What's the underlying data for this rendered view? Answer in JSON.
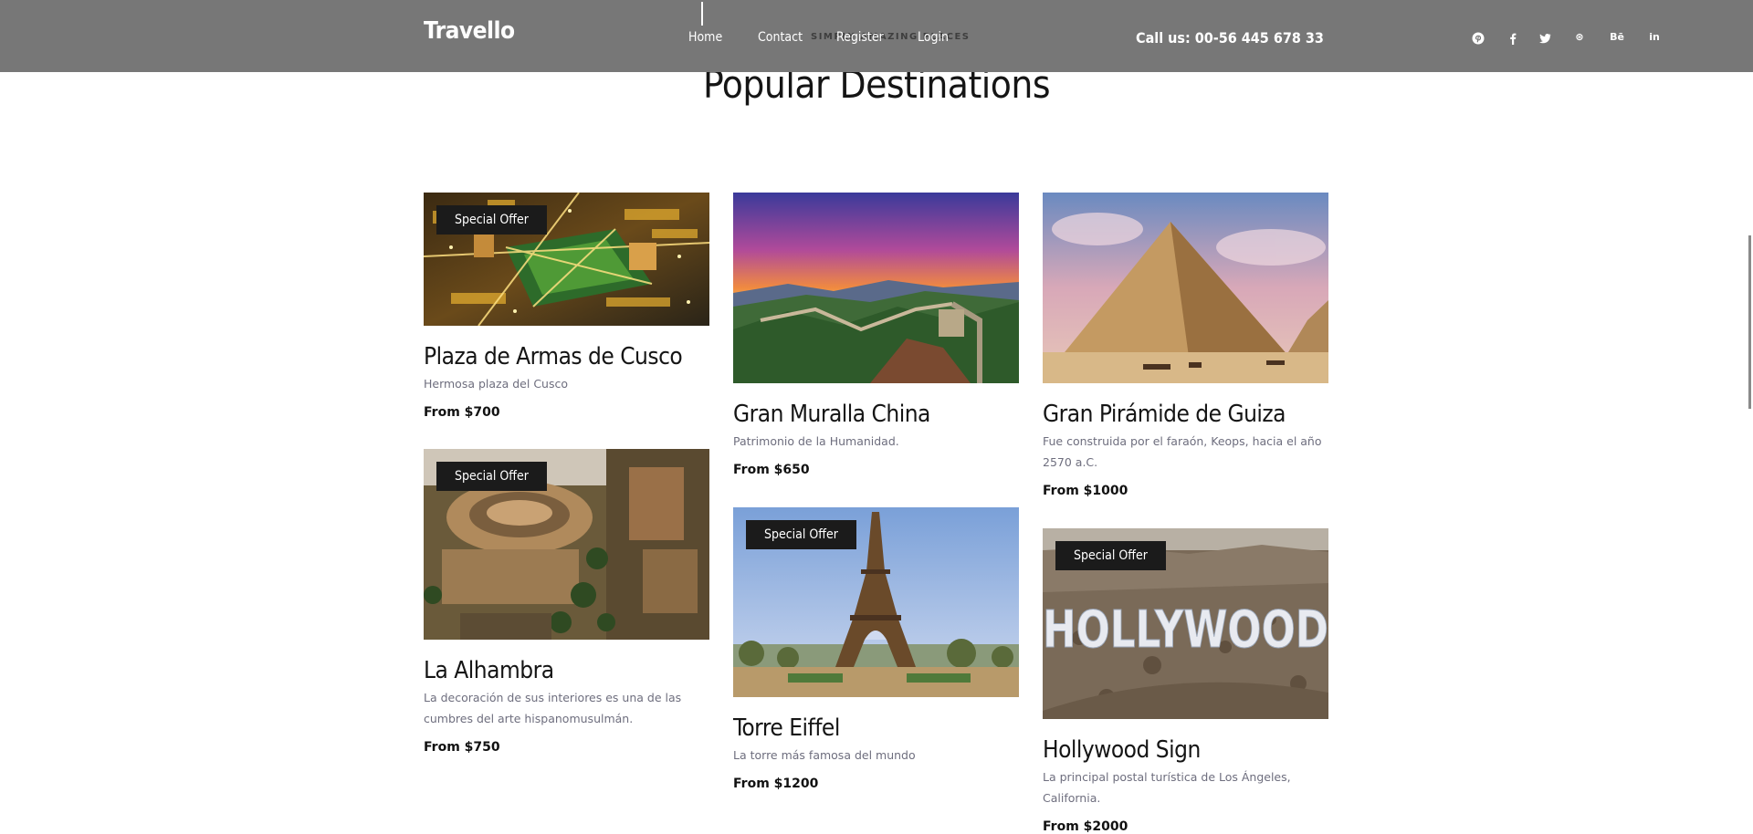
{
  "header": {
    "brand": "Travello",
    "ghost_text": "SIMPLY AMAZING PLACES",
    "nav": [
      {
        "label": "Home"
      },
      {
        "label": "Contact"
      },
      {
        "label": "Register"
      },
      {
        "label": "Login"
      }
    ],
    "phone": "Call us: 00-56 445 678 33",
    "social": [
      {
        "icon": "pinterest-icon"
      },
      {
        "icon": "facebook-icon"
      },
      {
        "icon": "twitter-icon"
      },
      {
        "icon": "dribbble-icon",
        "label": "⊛"
      },
      {
        "icon": "behance-icon",
        "label": "Bē"
      },
      {
        "icon": "linkedin-icon",
        "label": "in"
      }
    ]
  },
  "section": {
    "title": "Popular Destinations"
  },
  "destinations": [
    {
      "name": "Plaza de Armas de Cusco",
      "description": "Hermosa plaza del Cusco",
      "price": "From $700",
      "badge": "Special Offer"
    },
    {
      "name": "La Alhambra",
      "description": "La decoración de sus interiores es una de las cumbres del arte hispanomusulmán.",
      "price": "From $750",
      "badge": "Special Offer"
    },
    {
      "name": "Gran Muralla China",
      "description": "Patrimonio de la Humanidad.",
      "price": "From $650"
    },
    {
      "name": "Torre Eiffel",
      "description": "La torre más famosa del mundo",
      "price": "From $1200",
      "badge": "Special Offer"
    },
    {
      "name": "Gran Pirámide de Guiza",
      "description": "Fue construida por el faraón, Keops, hacia el año 2570 a.C.",
      "price": "From $1000"
    },
    {
      "name": "Hollywood Sign",
      "description": "La principal postal turística de Los Ángeles, California.",
      "price": "From $2000",
      "badge": "Special Offer",
      "sign_text": "HOLLYWOOD"
    }
  ],
  "colors": {
    "header_bg": "#777777",
    "badge_bg": "#1b1b1b",
    "title": "#151515",
    "description": "#6e6e7e"
  }
}
